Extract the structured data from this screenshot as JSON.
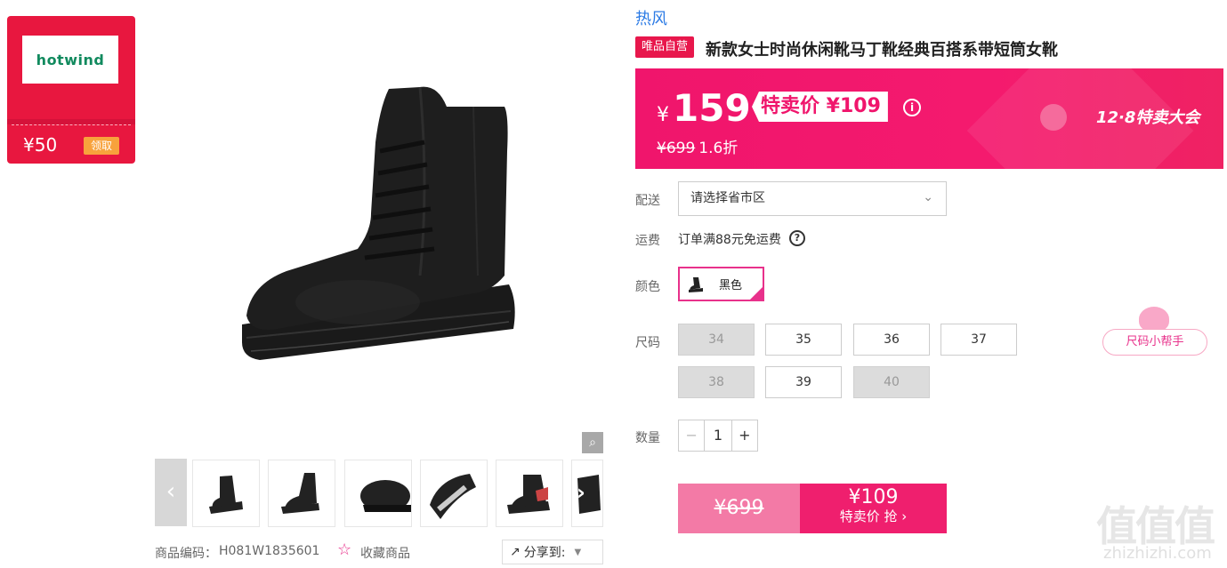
{
  "coupon": {
    "logo": "hotwind",
    "amount": "¥50",
    "button": "领取"
  },
  "gallery": {
    "zoom_icon": "magnifier-icon",
    "prev": "‹",
    "next": "›",
    "thumb_count": 6
  },
  "meta": {
    "sku_label": "商品编码：",
    "sku": "H081W1835601",
    "favorite": "收藏商品",
    "share": "分享到:"
  },
  "product": {
    "brand": "热风",
    "tag": "唯品自营",
    "title": "新款女士时尚休闲靴马丁靴经典百搭系带短筒女靴"
  },
  "price": {
    "current": "159",
    "currency": "¥",
    "sale_label": "特卖价 ¥109",
    "original": "¥699",
    "discount": "1.6折",
    "event": "12·8特卖大会"
  },
  "delivery": {
    "label": "配送",
    "placeholder": "请选择省市区"
  },
  "shipping": {
    "label": "运费",
    "text": "订单满88元免运费"
  },
  "color": {
    "label": "颜色",
    "selected": "黑色"
  },
  "size": {
    "label": "尺码",
    "options": [
      {
        "value": "34",
        "available": false
      },
      {
        "value": "35",
        "available": true
      },
      {
        "value": "36",
        "available": true
      },
      {
        "value": "37",
        "available": true
      },
      {
        "value": "38",
        "available": false
      },
      {
        "value": "39",
        "available": true
      },
      {
        "value": "40",
        "available": false
      }
    ],
    "helper": "尺码小帮手"
  },
  "quantity": {
    "label": "数量",
    "value": "1",
    "minus": "−",
    "plus": "+"
  },
  "buy": {
    "original": "¥699",
    "price": "¥109",
    "action": "特卖价 抢 ›"
  },
  "watermark": {
    "main": "值值值",
    "sub": "zhizhizhi.com"
  },
  "colors": {
    "accent": "#f0156c",
    "brand_blue": "#2c7be5",
    "coupon_red": "#e8173f"
  }
}
